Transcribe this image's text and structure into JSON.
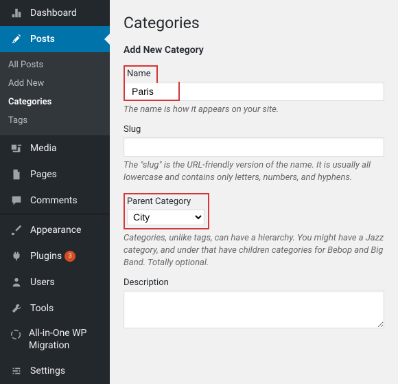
{
  "sidebar": {
    "dashboard": "Dashboard",
    "posts": "Posts",
    "submenu": {
      "all_posts": "All Posts",
      "add_new": "Add New",
      "categories": "Categories",
      "tags": "Tags"
    },
    "media": "Media",
    "pages": "Pages",
    "comments": "Comments",
    "appearance": "Appearance",
    "plugins": "Plugins",
    "plugins_count": "3",
    "users": "Users",
    "tools": "Tools",
    "migration": "All-in-One WP Migration",
    "settings": "Settings"
  },
  "page": {
    "title": "Categories",
    "subtitle": "Add New Category",
    "name_label": "Name",
    "name_value": "Paris",
    "name_desc": "The name is how it appears on your site.",
    "slug_label": "Slug",
    "slug_value": "",
    "slug_desc": "The \"slug\" is the URL-friendly version of the name. It is usually all lowercase and contains only letters, numbers, and hyphens.",
    "parent_label": "Parent Category",
    "parent_value": "City",
    "parent_desc": "Categories, unlike tags, can have a hierarchy. You might have a Jazz category, and under that have children categories for Bebop and Big Band. Totally optional.",
    "desc_label": "Description"
  }
}
